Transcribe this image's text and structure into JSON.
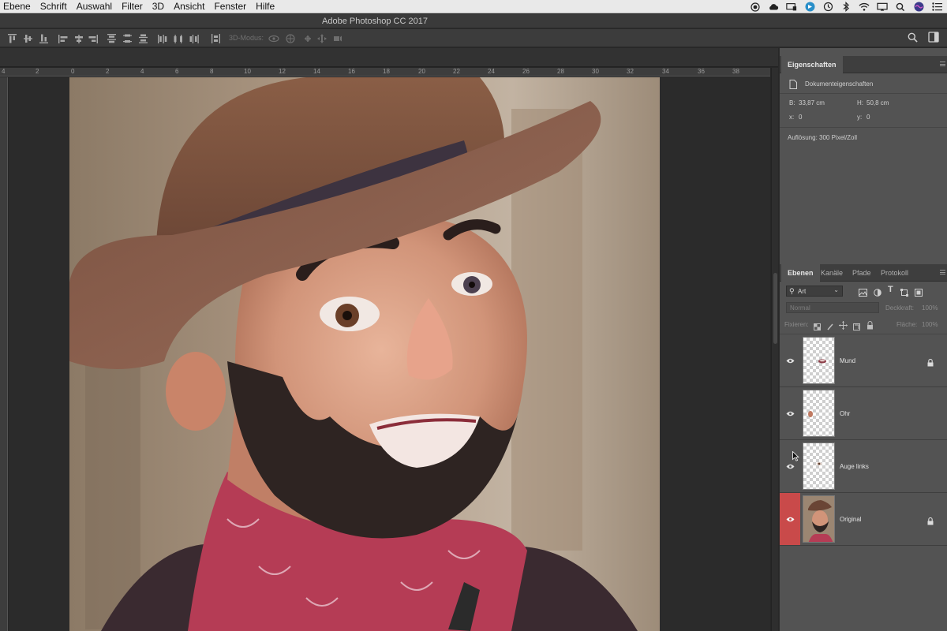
{
  "menubar": {
    "items": [
      "Ebene",
      "Schrift",
      "Auswahl",
      "Filter",
      "3D",
      "Ansicht",
      "Fenster",
      "Hilfe"
    ]
  },
  "window": {
    "title": "Adobe Photoshop CC 2017"
  },
  "options_bar": {
    "mode_3d_label": "3D-Modus:"
  },
  "ruler": {
    "ticks": [
      "4",
      "2",
      "0",
      "2",
      "4",
      "6",
      "8",
      "10",
      "12",
      "14",
      "16",
      "18",
      "20",
      "22",
      "24",
      "26",
      "28",
      "30",
      "32",
      "34",
      "36",
      "38"
    ]
  },
  "properties": {
    "tab_label": "Eigenschaften",
    "section_label": "Dokumenteigenschaften",
    "width_label": "B:",
    "width_value": "33,87 cm",
    "height_label": "H:",
    "height_value": "50,8 cm",
    "x_label": "x:",
    "x_value": "0",
    "y_label": "y:",
    "y_value": "0",
    "resolution": "Auflösung: 300 Pixel/Zoll"
  },
  "layers_panel": {
    "tabs": [
      "Ebenen",
      "Kanäle",
      "Pfade",
      "Protokoll"
    ],
    "filter_label": "Art",
    "blend_mode": "Normal",
    "opacity_label": "Deckkraft:",
    "opacity_value": "100%",
    "lock_label": "Fixieren:",
    "fill_label": "Fläche:",
    "fill_value": "100%",
    "layers": [
      {
        "name": "Mund",
        "locked": true,
        "selected": false
      },
      {
        "name": "Ohr",
        "locked": false,
        "selected": false
      },
      {
        "name": "Auge links",
        "locked": false,
        "selected": false
      },
      {
        "name": "Original",
        "locked": true,
        "selected": true
      }
    ]
  },
  "colors": {
    "accent_selected": "#c94a4a",
    "panel_bg": "#535353",
    "workspace_bg": "#262626"
  }
}
